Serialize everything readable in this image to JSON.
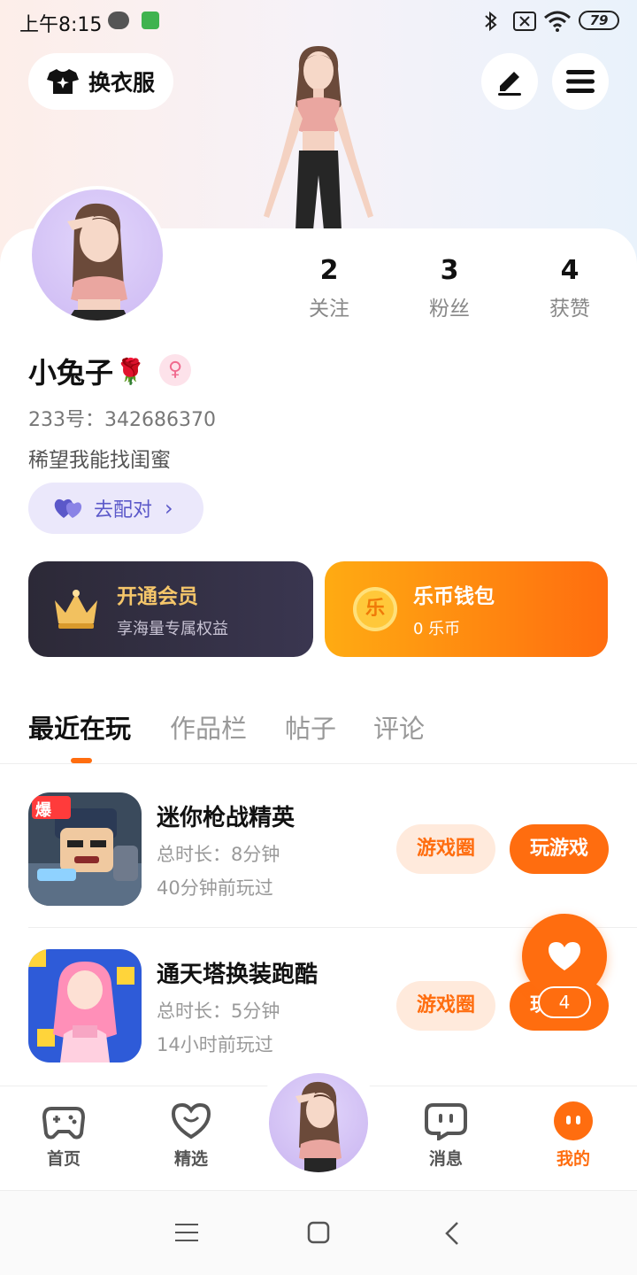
{
  "status_bar": {
    "time": "上午8:15",
    "battery": "79"
  },
  "header": {
    "outfit_label": "换衣服",
    "edit_icon": "pen-icon",
    "menu_icon": "menu-icon"
  },
  "profile": {
    "username": "小兔子",
    "username_emoji": "🌹",
    "gender_symbol": "♀",
    "uid": "233号：342686370",
    "bio": "稀望我能找闺蜜",
    "match_label": "去配对",
    "stats": [
      {
        "value": "2",
        "label": "关注"
      },
      {
        "value": "3",
        "label": "粉丝"
      },
      {
        "value": "4",
        "label": "获赞"
      }
    ]
  },
  "vip": {
    "title": "开通会员",
    "subtitle": "享海量专属权益"
  },
  "wallet": {
    "coin_glyph": "乐",
    "title": "乐币钱包",
    "subtitle": "0 乐币"
  },
  "tabs": [
    {
      "label": "最近在玩"
    },
    {
      "label": "作品栏"
    },
    {
      "label": "帖子"
    },
    {
      "label": "评论"
    }
  ],
  "games": [
    {
      "name": "迷你枪战精英",
      "duration": "总时长：8分钟",
      "last_played": "40分钟前玩过",
      "circle_label": "游戏圈",
      "play_label": "玩游戏",
      "badge": "爆"
    },
    {
      "name": "通天塔换装跑酷",
      "duration": "总时长：5分钟",
      "last_played": "14小时前玩过",
      "circle_label": "游戏圈",
      "play_label": "玩游戏"
    }
  ],
  "fab": {
    "count": "4"
  },
  "bottom_nav": [
    {
      "label": "首页"
    },
    {
      "label": "精选"
    },
    {
      "label": "消息"
    },
    {
      "label": "我的"
    }
  ],
  "colors": {
    "accent": "#ff6d0f",
    "vip_gold": "#f5c66a",
    "match_purple": "#5b58c9"
  }
}
